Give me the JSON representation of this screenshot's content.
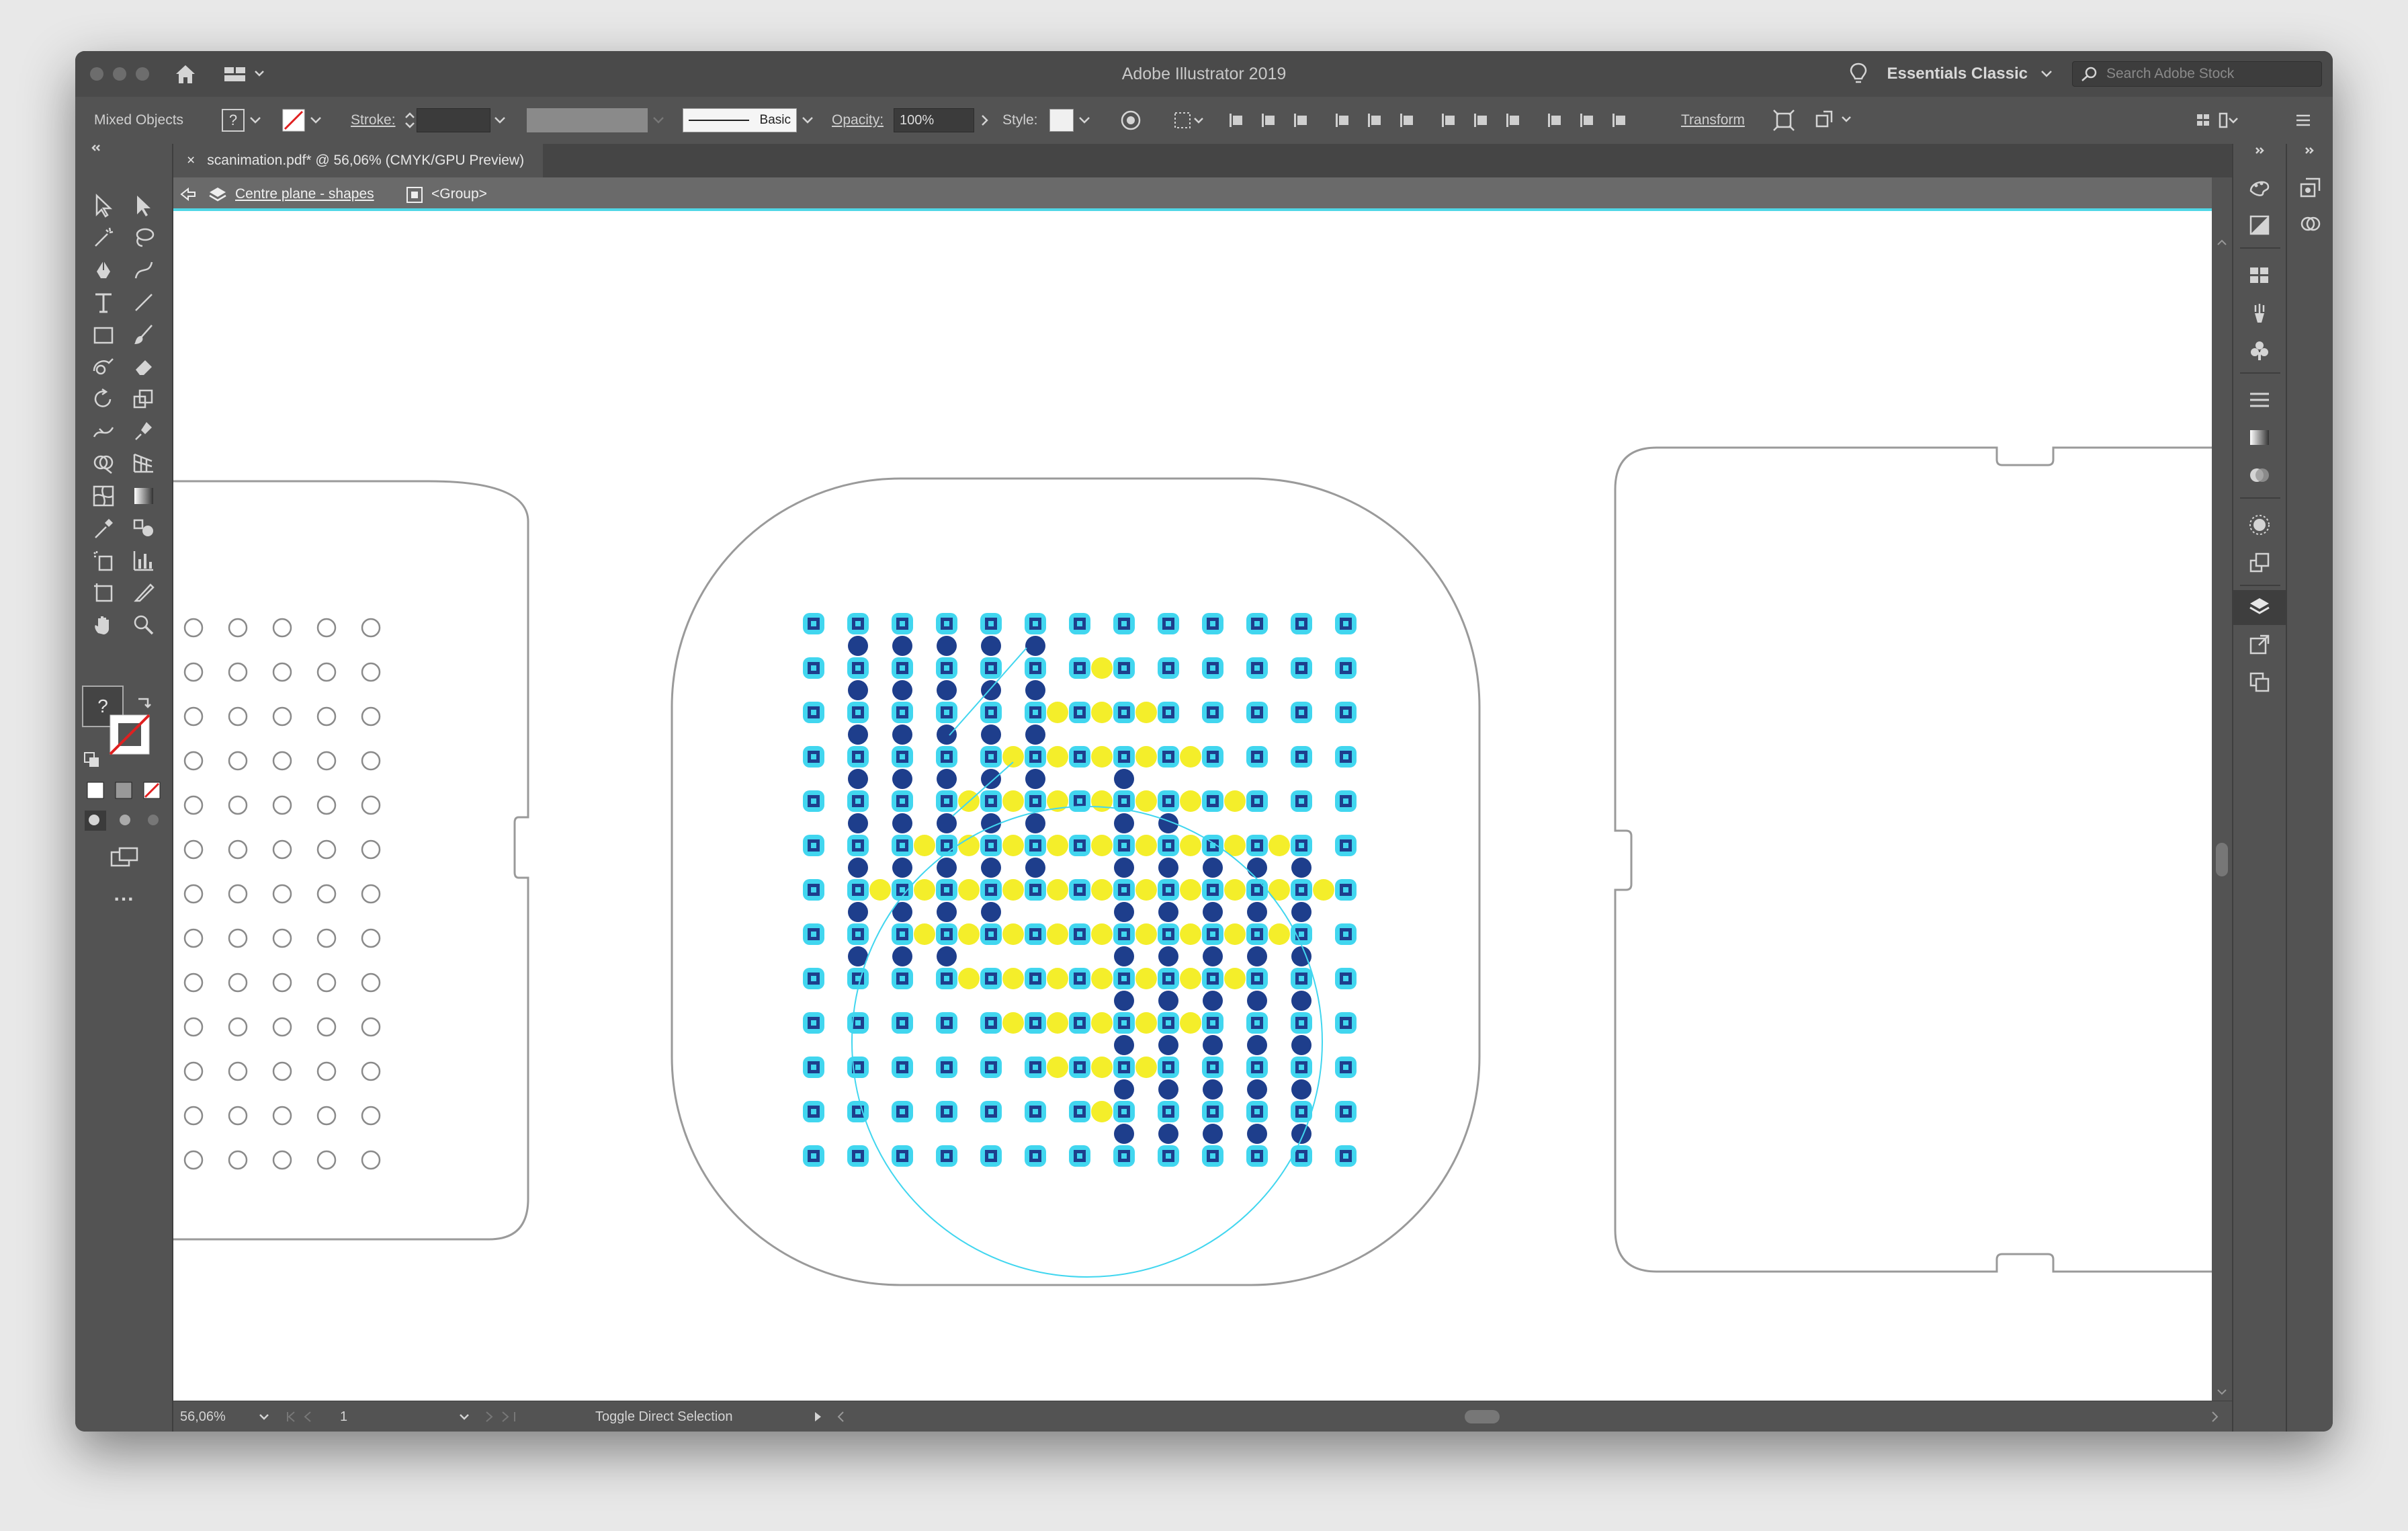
{
  "app": {
    "title": "Adobe Illustrator 2019"
  },
  "titlebar": {
    "workspace": "Essentials Classic",
    "search_placeholder": "Search Adobe Stock"
  },
  "controlbar": {
    "selection": "Mixed Objects",
    "fill_label": "?",
    "stroke_label": "Stroke:",
    "brush": "Basic",
    "opacity_label": "Opacity:",
    "opacity_value": "100%",
    "style_label": "Style:",
    "transform_label": "Transform"
  },
  "document": {
    "tab_title": "scanimation.pdf* @ 56,06% (CMYK/GPU Preview)",
    "close_glyph": "×"
  },
  "breadcrumb": {
    "layer": "Centre plane - shapes",
    "group": "<Group>"
  },
  "toolbar": {
    "fill_swatch_label": "?",
    "more_label": "..."
  },
  "statusbar": {
    "zoom": "56,06%",
    "artboard": "1",
    "tool_status": "Toggle Direct Selection"
  },
  "colors": {
    "cyan": "#41d6ef",
    "navy": "#1e3e8c",
    "yellow": "#f4ee2a"
  },
  "icons": [
    "home-icon",
    "layout-icon",
    "lightbulb-icon",
    "search-icon",
    "selection-tool-icon",
    "direct-selection-tool-icon",
    "magic-wand-icon",
    "lasso-icon",
    "pen-icon",
    "type-icon",
    "line-icon",
    "rectangle-icon",
    "paintbrush-icon",
    "eraser-icon",
    "rotate-icon",
    "scale-icon",
    "eyedropper-icon",
    "graph-icon",
    "hand-icon",
    "zoom-icon",
    "layers-icon"
  ]
}
